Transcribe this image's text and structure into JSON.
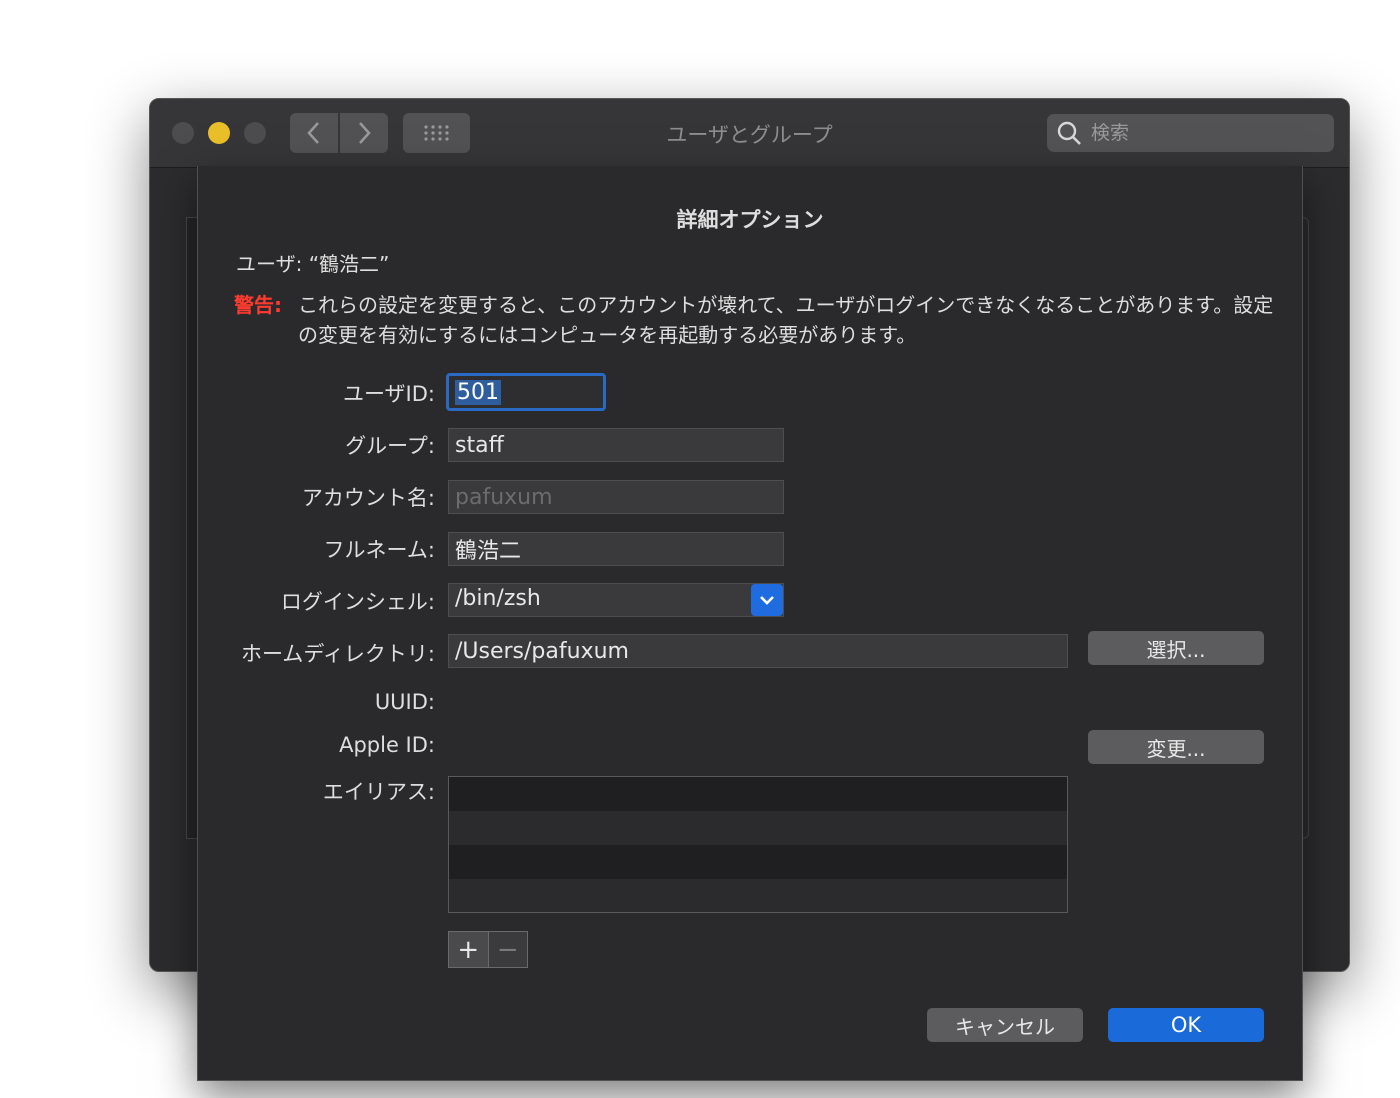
{
  "window": {
    "title": "ユーザとグループ",
    "search_placeholder": "検索"
  },
  "dialog": {
    "title": "詳細オプション",
    "user_line": "ユーザ: “鶴浩二”",
    "warning_label": "警告:",
    "warning_text": "これらの設定を変更すると、このアカウントが壊れて、ユーザがログインできなくなることがあります。設定の変更を有効にするにはコンピュータを再起動する必要があります。",
    "fields": {
      "user_id": {
        "label": "ユーザID:",
        "value": "501"
      },
      "group": {
        "label": "グループ:",
        "value": "staff"
      },
      "account_name": {
        "label": "アカウント名:",
        "value": "pafuxum"
      },
      "full_name": {
        "label": "フルネーム:",
        "value": "鶴浩二"
      },
      "login_shell": {
        "label": "ログインシェル:",
        "value": "/bin/zsh"
      },
      "home_directory": {
        "label": "ホームディレクトリ:",
        "value": "/Users/pafuxum"
      },
      "uuid": {
        "label": "UUID:",
        "value": ""
      },
      "apple_id": {
        "label": "Apple ID:",
        "value": ""
      },
      "aliases": {
        "label": "エイリアス:",
        "rows": [
          "",
          "",
          "",
          ""
        ]
      }
    },
    "buttons": {
      "choose": "選択...",
      "change": "変更...",
      "add": "+",
      "remove": "−",
      "cancel": "キャンセル",
      "ok": "OK"
    }
  },
  "colors": {
    "accent": "#1a6ad9",
    "warning": "#ff3b30",
    "minimize": "#e9c02a"
  }
}
